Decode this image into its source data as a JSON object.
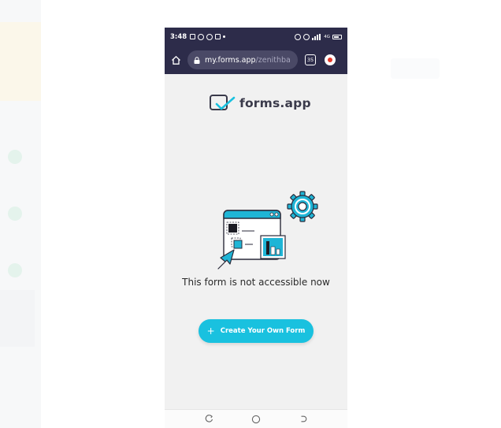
{
  "status_bar": {
    "time": "3:48",
    "network": "4G"
  },
  "browser": {
    "url_domain": "my.forms.app",
    "url_path": "/zenithba",
    "tab_count": "35"
  },
  "brand": {
    "name": "forms.app"
  },
  "content": {
    "message": "This form is not accessible now",
    "cta_label": "Create Your Own Form",
    "cta_icon": "+"
  },
  "colors": {
    "browser_chrome": "#2d2c4a",
    "accent": "#19c1df",
    "page_background": "#f1f1f1"
  },
  "icons": {
    "status_left": [
      "gallery-icon",
      "whatsapp-icon",
      "messenger-icon",
      "mail-icon"
    ],
    "status_right": [
      "alarm-icon",
      "hotspot-icon",
      "signal-icon",
      "battery-icon"
    ],
    "browser": [
      "home-icon",
      "lock-icon",
      "tabs-icon",
      "extension-icon"
    ],
    "navigation": [
      "recent-apps-icon",
      "home-nav-icon",
      "back-icon"
    ]
  }
}
